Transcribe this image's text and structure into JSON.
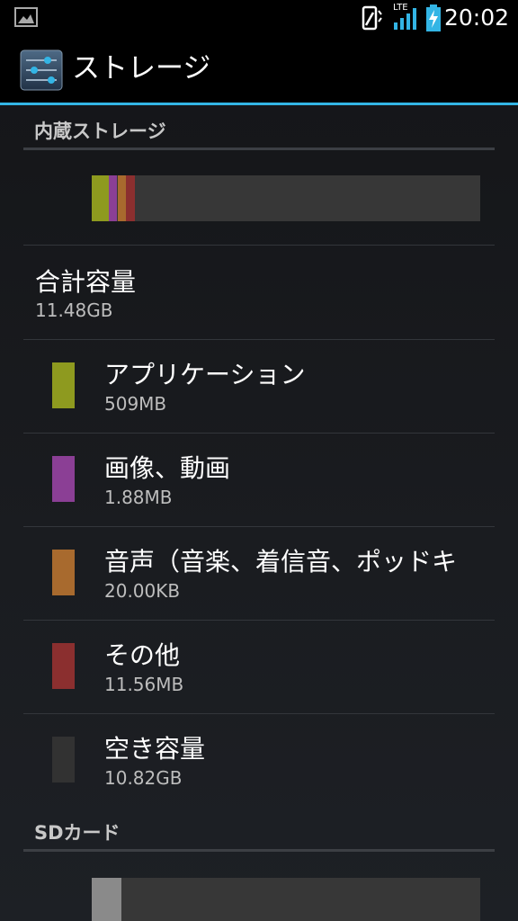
{
  "status_bar": {
    "time": "20:02",
    "network_label": "LTE",
    "icons": [
      "image-notification-icon",
      "vibrate-icon",
      "signal-icon",
      "battery-charging-icon"
    ]
  },
  "action_bar": {
    "title": "ストレージ",
    "icon": "settings-sliders-icon",
    "accent_color": "#33b5e5"
  },
  "internal_storage": {
    "header": "内蔵ストレージ",
    "usage_segments": [
      {
        "name": "apps",
        "color": "#8e9a1f",
        "fraction": 0.043
      },
      {
        "name": "images",
        "color": "#8b3f95",
        "fraction": 0.023
      },
      {
        "name": "audio",
        "color": "#a86a2e",
        "fraction": 0.021
      },
      {
        "name": "other",
        "color": "#8b2f2f",
        "fraction": 0.025
      }
    ],
    "total": {
      "label": "合計容量",
      "value": "11.48GB"
    },
    "categories": [
      {
        "title": "アプリケーション",
        "value": "509MB",
        "color": "#8e9a1f"
      },
      {
        "title": "画像、動画",
        "value": "1.88MB",
        "color": "#8b3f95"
      },
      {
        "title": "音声（音楽、着信音、ポッドキ",
        "value": "20.00KB",
        "color": "#a86a2e"
      },
      {
        "title": "その他",
        "value": "11.56MB",
        "color": "#8b2f2f"
      },
      {
        "title": "空き容量",
        "value": "10.82GB",
        "color": "#323232"
      }
    ]
  },
  "sd_card": {
    "header": "SDカード",
    "usage_segments": [
      {
        "name": "used",
        "color": "#8a8a8a",
        "fraction": 0.076
      }
    ]
  }
}
